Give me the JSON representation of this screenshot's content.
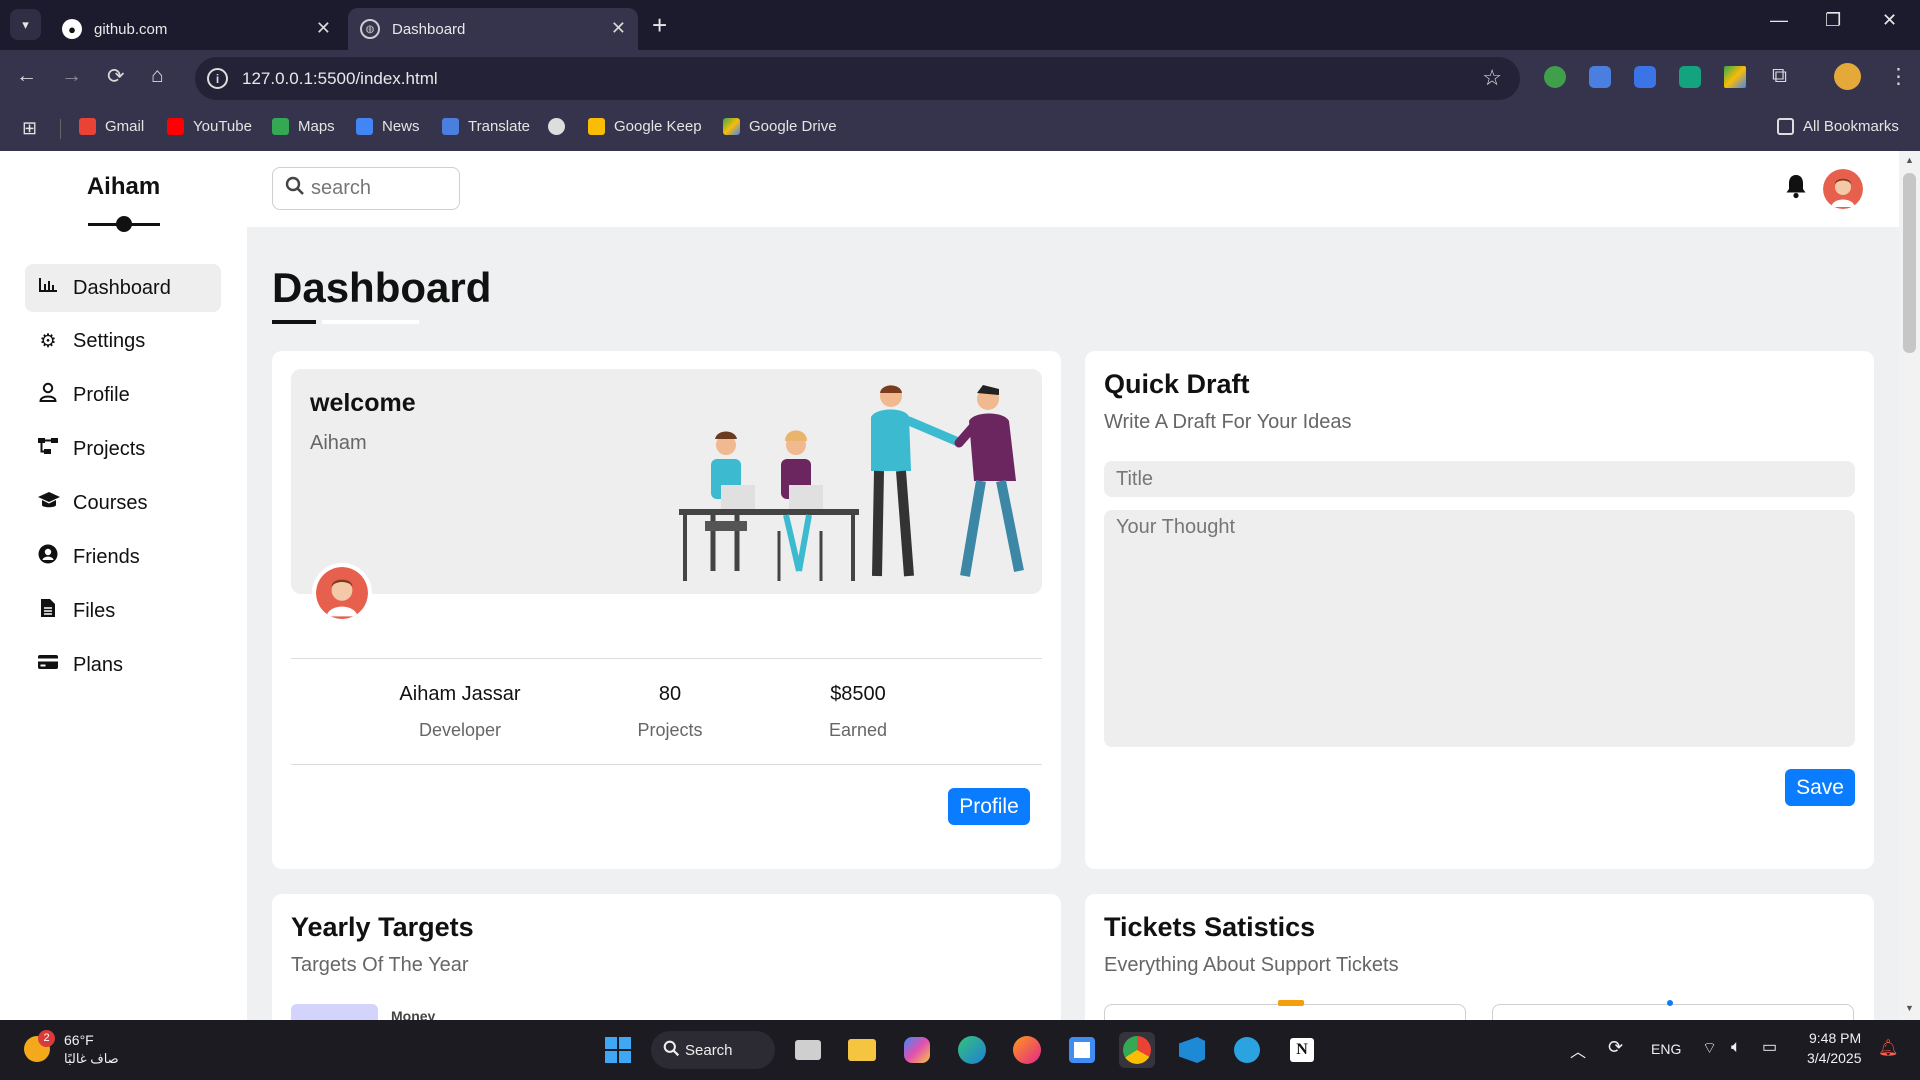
{
  "browser": {
    "tabs": [
      {
        "title": "github.com",
        "active": false
      },
      {
        "title": "Dashboard",
        "active": true
      }
    ],
    "url": "127.0.0.1:5500/index.html",
    "bookmarks": [
      "Gmail",
      "YouTube",
      "Maps",
      "News",
      "Translate",
      "Google Keep",
      "Google Drive"
    ],
    "all_bookmarks": "All Bookmarks"
  },
  "sidebar": {
    "brand": "Aiham",
    "items": [
      {
        "label": "Dashboard",
        "icon": "chart-icon",
        "active": true
      },
      {
        "label": "Settings",
        "icon": "gear-icon"
      },
      {
        "label": "Profile",
        "icon": "user-icon"
      },
      {
        "label": "Projects",
        "icon": "diagram-icon"
      },
      {
        "label": "Courses",
        "icon": "graduation-cap-icon"
      },
      {
        "label": "Friends",
        "icon": "user-circle-icon"
      },
      {
        "label": "Files",
        "icon": "file-icon"
      },
      {
        "label": "Plans",
        "icon": "credit-card-icon"
      }
    ]
  },
  "header": {
    "search_placeholder": "search"
  },
  "main": {
    "title": "Dashboard",
    "welcome": {
      "greeting": "welcome",
      "name": "Aiham",
      "stats": [
        {
          "value": "Aiham Jassar",
          "label": "Developer"
        },
        {
          "value": "80",
          "label": "Projects"
        },
        {
          "value": "$8500",
          "label": "Earned"
        }
      ],
      "button": "Profile"
    },
    "draft": {
      "title": "Quick Draft",
      "subtitle": "Write A Draft For Your Ideas",
      "title_placeholder": "Title",
      "body_placeholder": "Your Thought",
      "button": "Save"
    },
    "targets": {
      "title": "Yearly Targets",
      "subtitle": "Targets Of The Year",
      "first_item": "Money"
    },
    "tickets": {
      "title": "Tickets Satistics",
      "subtitle": "Everything About Support Tickets"
    }
  },
  "taskbar": {
    "weather_temp": "66°F",
    "weather_desc": "صاف غالبًا",
    "weather_badge": "2",
    "search_label": "Search",
    "lang": "ENG",
    "time": "9:48 PM",
    "date": "3/4/2025"
  },
  "colors": {
    "accent": "#0a7cff",
    "page_bg": "#eef0f2",
    "chrome_dark": "#1c1b2e",
    "chrome_mid": "#35344c"
  }
}
